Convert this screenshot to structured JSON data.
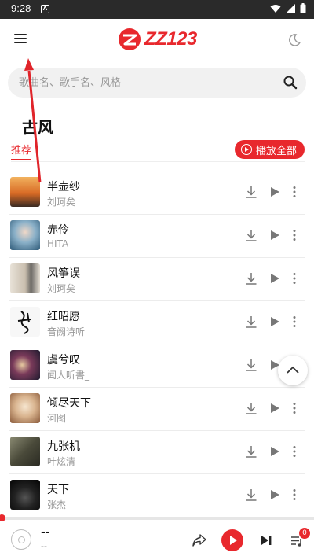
{
  "status_bar": {
    "time": "9:28",
    "notification_glyph": "A"
  },
  "header": {
    "logo_text": "ZZ123",
    "menu_icon": "menu-icon",
    "theme_icon": "moon-icon"
  },
  "search": {
    "placeholder": "歌曲名、歌手名、风格",
    "value": ""
  },
  "page": {
    "title": "古风"
  },
  "tabs": {
    "active": "推荐",
    "play_all_label": "播放全部"
  },
  "songs": [
    {
      "title": "半壶纱",
      "artist": "刘珂矣",
      "cover_color": "#c86a2c"
    },
    {
      "title": "赤伶",
      "artist": "HITA",
      "cover_color": "#4a7fa0"
    },
    {
      "title": "风筝误",
      "artist": "刘珂矣",
      "cover_color": "#d8d0c4"
    },
    {
      "title": "红昭愿",
      "artist": "音阙诗听",
      "cover_color": "#f2f2f2"
    },
    {
      "title": "虞兮叹",
      "artist": "闻人听書_",
      "cover_color": "#3a2a3e"
    },
    {
      "title": "倾尽天下",
      "artist": "河图",
      "cover_color": "#d9b48f"
    },
    {
      "title": "九张机",
      "artist": "叶炫清",
      "cover_color": "#5a5a4a"
    },
    {
      "title": "天下",
      "artist": "张杰",
      "cover_color": "#111111"
    }
  ],
  "now_playing": {
    "title": "--",
    "artist": "--",
    "progress": 0,
    "queue_count": "0"
  },
  "colors": {
    "accent": "#e8282d",
    "status_bar": "#2a2a2a"
  }
}
